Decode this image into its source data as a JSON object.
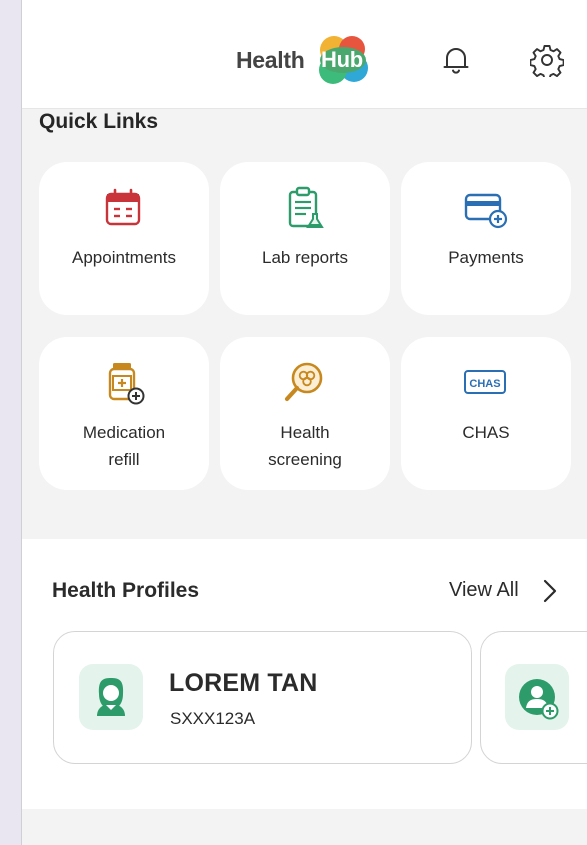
{
  "header": {
    "logo_text": "Health",
    "logo_highlight": "Hub"
  },
  "quick_links": {
    "title": "Quick Links",
    "items": [
      {
        "label": "Appointments",
        "icon": "calendar-icon"
      },
      {
        "label": "Lab reports",
        "icon": "clipboard-flask-icon"
      },
      {
        "label": "Payments",
        "icon": "credit-card-add-icon"
      },
      {
        "label_line1": "Medication",
        "label_line2": "refill",
        "icon": "medicine-bottle-add-icon"
      },
      {
        "label_line1": "Health",
        "label_line2": "screening",
        "icon": "magnifier-cells-icon"
      },
      {
        "label": "CHAS",
        "icon": "chas-card-icon",
        "icon_text": "CHAS"
      }
    ]
  },
  "health_profiles": {
    "title": "Health Profiles",
    "view_all": "View All",
    "profiles": [
      {
        "name": "LOREM TAN",
        "id": "SXXX123A"
      }
    ]
  },
  "colors": {
    "accent_red": "#c8343a",
    "accent_green": "#2e9b6a",
    "accent_blue": "#2a6fb3",
    "accent_orange": "#c7891f",
    "background": "#f3f3f3"
  }
}
